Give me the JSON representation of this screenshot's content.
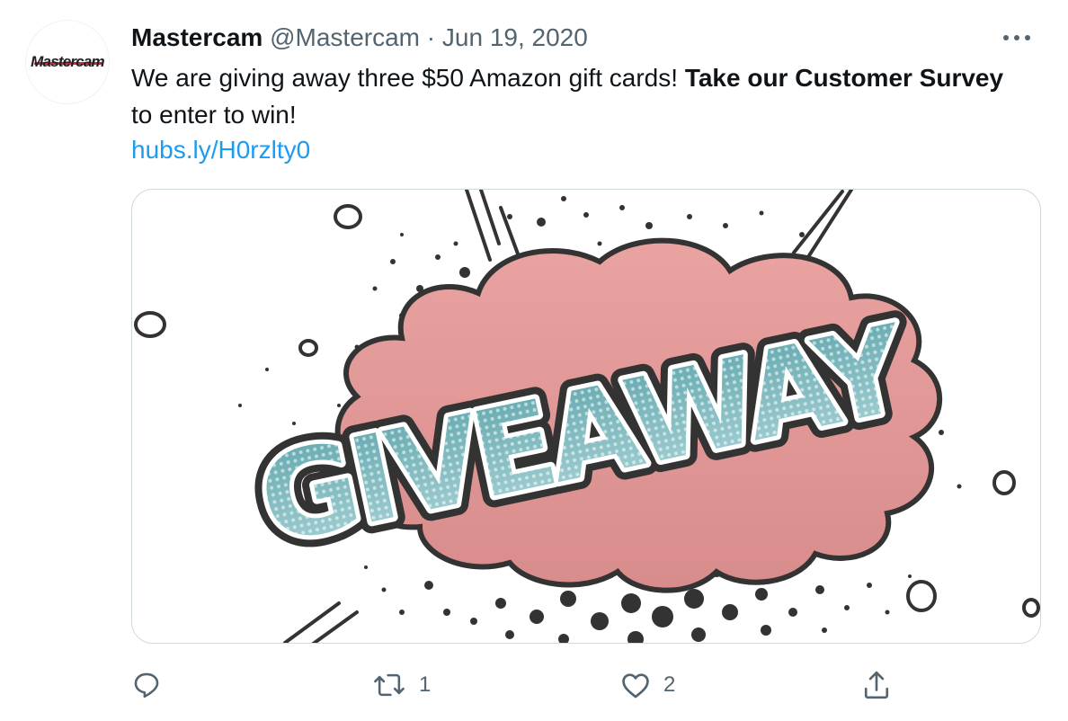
{
  "tweet": {
    "avatar_text": "Mastercam",
    "display_name": "Mastercam",
    "handle": "@Mastercam",
    "separator": "·",
    "date": "Jun 19, 2020",
    "text_part1": "We are giving away three $50 Amazon gift cards! ",
    "text_bold": "Take our Customer Survey",
    "text_part2": " to enter to win!",
    "link": "hubs.ly/H0rzlty0",
    "image_text": "GIVEAWAY",
    "retweet_count": "1",
    "like_count": "2"
  },
  "colors": {
    "link": "#1d9bf0",
    "secondary_text": "#536471",
    "cloud": "#e09898",
    "letters": "#8cc3c7",
    "outline": "#333333"
  },
  "icons": {
    "reply": "reply-icon",
    "retweet": "retweet-icon",
    "like": "heart-icon",
    "share": "share-icon",
    "more": "more-icon"
  }
}
